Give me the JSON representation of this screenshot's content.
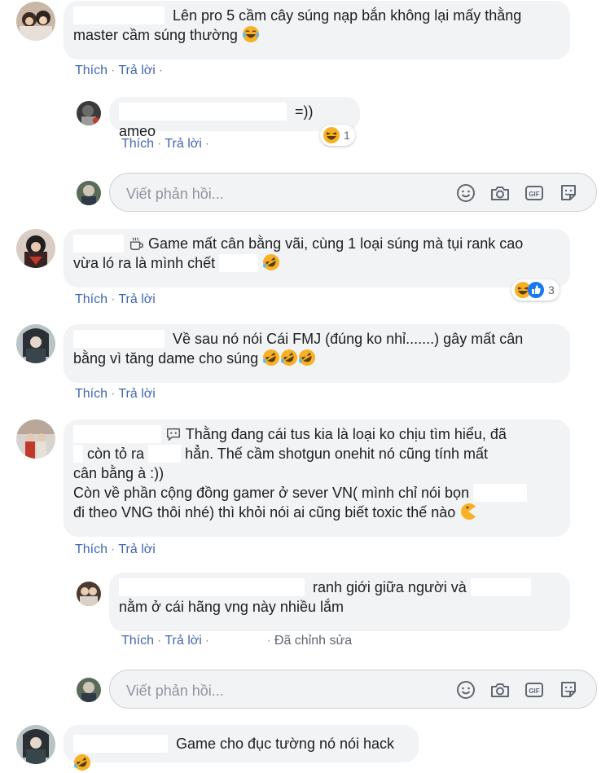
{
  "actions": {
    "like": "Thích",
    "reply": "Trả lời",
    "edited": "Đã chỉnh sửa"
  },
  "reply_placeholder": "Viết phản hồi...",
  "comments": [
    {
      "text1": "Lên pro 5 cầm cây súng nạp bắn không lại mấy thằng",
      "text2": "master cầm súng thường"
    },
    {
      "text1": "=)) ameo",
      "reaction_count": "1"
    },
    {
      "text1": "Game mất cân bằng vãi, cùng 1 loại súng mà tụi rank cao",
      "text2": "vừa ló ra là mình chết",
      "reaction_count": "3"
    },
    {
      "text1": "Về sau nó nói Cái FMJ (đúng ko nhỉ.......) gây mất cân",
      "text2": "bằng vì tăng dame cho súng"
    },
    {
      "text1": "Thằng đang cái tus kia là loại ko chịu tìm hiểu, đã",
      "text2a": "còn tỏ ra",
      "text2b": "hẳn. Thế cầm shotgun onehit nó cũng tính mất",
      "text3": "cân bằng à :))",
      "text4": "Còn về phần cộng đồng gamer ở sever VN( mình chỉ nói bọn",
      "text5": "đi theo VNG thôi nhé) thì khỏi nói ai cũng biết toxic thế nào"
    },
    {
      "text1": "ranh giới giữa người và",
      "text2": "nằm ở cái hãng vng này nhiều lắm"
    },
    {
      "text1": "Game cho đục tường nó nói hack"
    }
  ],
  "colors": {
    "link": "#4267b2",
    "bubble": "#f2f3f5",
    "text": "#1c1e21",
    "placeholder": "#90949c",
    "like_blue": "#1877f2",
    "emoji_yellow": "#f7b125"
  }
}
